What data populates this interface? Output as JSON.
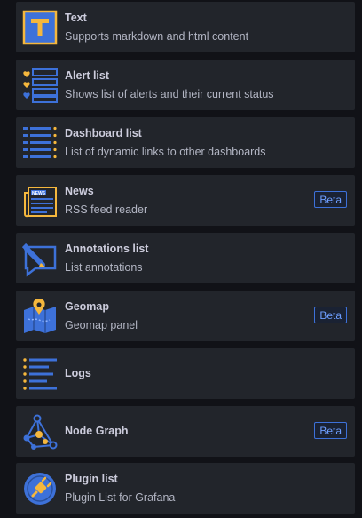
{
  "panels": [
    {
      "name": "Text",
      "description": "Supports markdown and html content",
      "icon": "text-panel-icon",
      "badge": ""
    },
    {
      "name": "Alert list",
      "description": "Shows list of alerts and their current status",
      "icon": "alert-list-icon",
      "badge": ""
    },
    {
      "name": "Dashboard list",
      "description": "List of dynamic links to other dashboards",
      "icon": "dashboard-list-icon",
      "badge": ""
    },
    {
      "name": "News",
      "description": "RSS feed reader",
      "icon": "news-icon",
      "badge": "Beta"
    },
    {
      "name": "Annotations list",
      "description": "List annotations",
      "icon": "annotations-list-icon",
      "badge": ""
    },
    {
      "name": "Geomap",
      "description": "Geomap panel",
      "icon": "geomap-icon",
      "badge": "Beta"
    },
    {
      "name": "Logs",
      "description": "",
      "icon": "logs-icon",
      "badge": ""
    },
    {
      "name": "Node Graph",
      "description": "",
      "icon": "node-graph-icon",
      "badge": "Beta"
    },
    {
      "name": "Plugin list",
      "description": "Plugin List for Grafana",
      "icon": "plugin-list-icon",
      "badge": ""
    }
  ],
  "colors": {
    "background": "#111217",
    "card": "#22252b",
    "icon_blue": "#3d71d9",
    "icon_orange": "#f5b73d",
    "badge": "#6e9fff"
  }
}
